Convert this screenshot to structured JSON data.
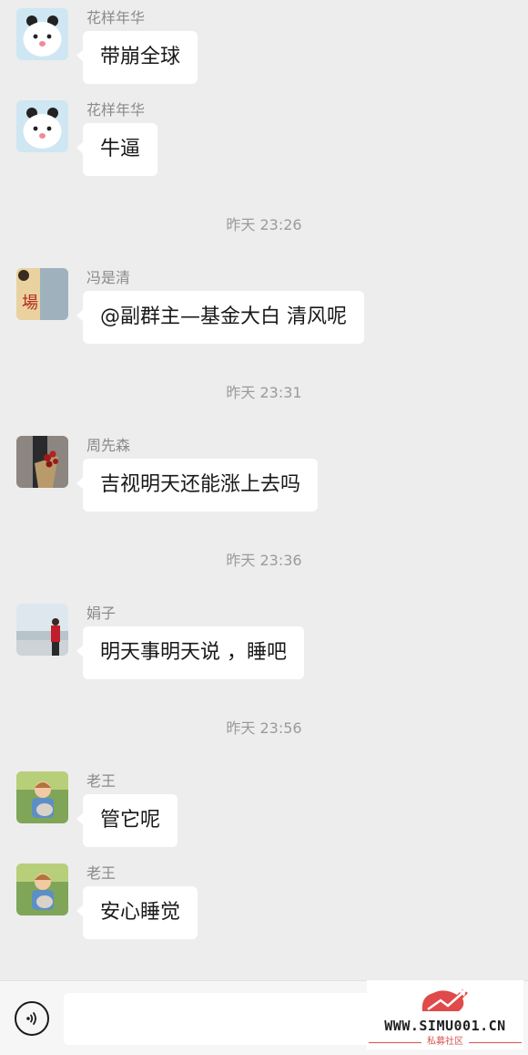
{
  "messages": [
    {
      "sender": "花样年华",
      "text": "带崩全球",
      "avatar": "panda-avatar"
    },
    {
      "sender": "花样年华",
      "text": "牛逼",
      "avatar": "panda-avatar"
    },
    {
      "sender": "冯是清",
      "text": "@副群主—基金大白  清风呢",
      "avatar": "calligraphy-avatar"
    },
    {
      "sender": "周先森",
      "text": "吉视明天还能涨上去吗",
      "avatar": "roses-avatar"
    },
    {
      "sender": "娟子",
      "text": "明天事明天说 ，睡吧",
      "avatar": "lakeside-woman-avatar"
    },
    {
      "sender": "老王",
      "text": "管它呢",
      "avatar": "boy-with-cat-avatar"
    },
    {
      "sender": "老王",
      "text": "安心睡觉",
      "avatar": "boy-with-cat-avatar"
    }
  ],
  "timestamps": [
    "昨天 23:26",
    "昨天 23:31",
    "昨天 23:36",
    "昨天 23:56"
  ],
  "input_bar": {
    "voice_icon": "voice-icon",
    "input_value": ""
  },
  "watermark": {
    "site": "WWW.SIMU001.CN",
    "tagline": "私募社区"
  },
  "colors": {
    "background": "#ededed",
    "bubble": "#ffffff",
    "watermark_accent": "#d9534f"
  }
}
